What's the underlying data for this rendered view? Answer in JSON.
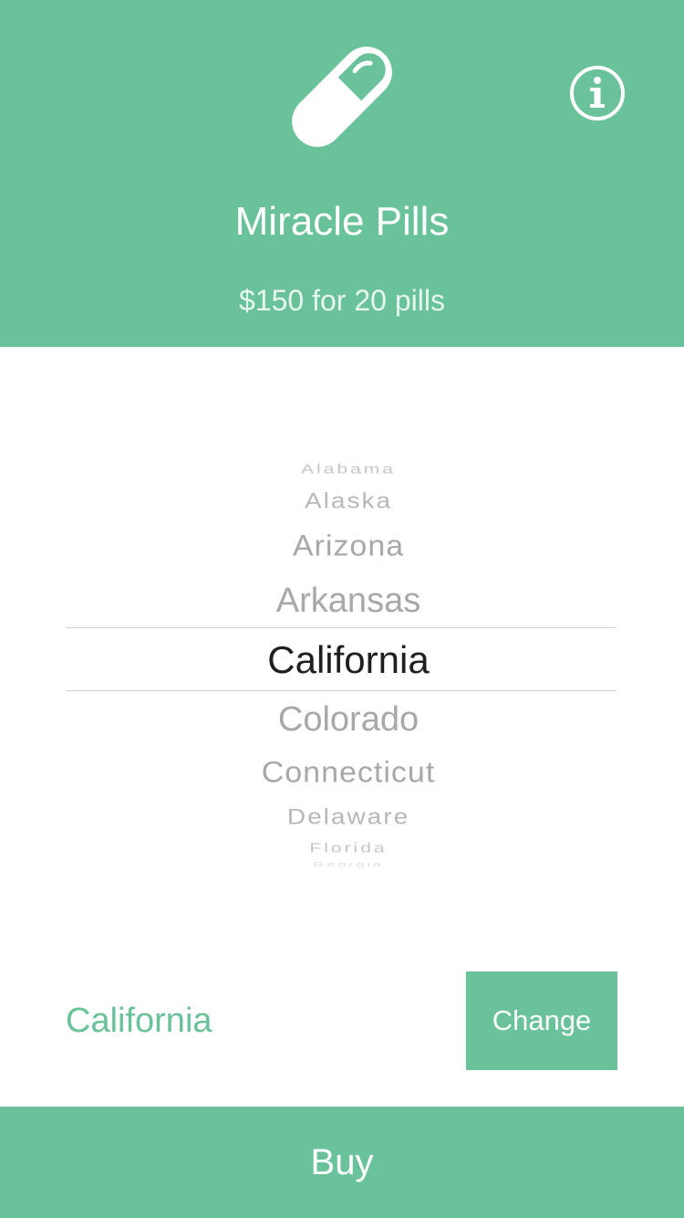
{
  "header": {
    "icon": "pill-icon",
    "info_icon": "info-icon",
    "title": "Miracle Pills",
    "price": "$150 for 20 pills",
    "background_color": "#69c299"
  },
  "picker": {
    "items": [
      "Alabama",
      "Alaska",
      "Arizona",
      "Arkansas",
      "California",
      "Colorado",
      "Connecticut",
      "Delaware",
      "Florida",
      "Georgia"
    ],
    "selected_index": 4,
    "selected": "California"
  },
  "selection": {
    "current_state": "California",
    "change_label": "Change"
  },
  "footer": {
    "buy_label": "Buy"
  },
  "colors": {
    "accent": "#69c299",
    "picker_selected": "#1f1f1f",
    "picker_unselected": "#a8a8a8"
  }
}
